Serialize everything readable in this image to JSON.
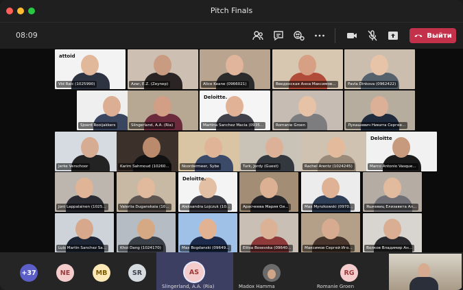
{
  "window": {
    "title": "Pitch Finals"
  },
  "toolbar": {
    "time": "08:09",
    "leave_label": "Выйти"
  },
  "participants": [
    {
      "name": "Vid Raic (1025990)",
      "bg": "#f3f3f3",
      "skin": "#e2b89a",
      "shirt": "#2d3340",
      "logo": "attoid"
    },
    {
      "name": "Azar, E.Z. (Zeynep)",
      "bg": "#cdbfb2",
      "skin": "#c99c82",
      "shirt": "#2a2424",
      "logo": ""
    },
    {
      "name": "Alice Keane (0966021)",
      "bg": "#b8a48f",
      "skin": "#e0b59b",
      "shirt": "#2b2b2b",
      "logo": ""
    },
    {
      "name": "Введенская Анна Максимов...",
      "bg": "#d7c6b0",
      "skin": "#d7a084",
      "shirt": "#b24c3a",
      "logo": ""
    },
    {
      "name": "Pavla Dinkova (0962422)",
      "bg": "#cbbeaf",
      "skin": "#e7c3a7",
      "shirt": "#56616e",
      "logo": ""
    },
    {
      "name": "Sjoerd Rooijakkers",
      "bg": "#efefef",
      "skin": "#dcae93",
      "shirt": "#3a4660",
      "logo": ""
    },
    {
      "name": "Slingerland, A.A. (Ria)",
      "bg": "#b6a892",
      "skin": "#d29e86",
      "shirt": "#6b2b3d",
      "logo": ""
    },
    {
      "name": "Martina Sanchez Macia (0935...",
      "bg": "#f5f5f5",
      "skin": "#e1b296",
      "shirt": "#40414a",
      "logo": "Deloitte."
    },
    {
      "name": "Romanie Groen",
      "bg": "#c6bcb3",
      "skin": "#e6c2a6",
      "shirt": "#7d7d80",
      "logo": ""
    },
    {
      "name": "Лукашевич Никита Сергее...",
      "bg": "#b6ad9f",
      "skin": "#dbb096",
      "shirt": "#1f2a3d",
      "logo": ""
    },
    {
      "name": "Jerke Verschoor",
      "bg": "#d6dbe1",
      "skin": "#d6ad93",
      "shirt": "#232323",
      "logo": ""
    },
    {
      "name": "Karim Sahmoud (10260...",
      "bg": "#3b302a",
      "skin": "#b98a6c",
      "shirt": "#121212",
      "logo": ""
    },
    {
      "name": "Noordermeer, Sybe",
      "bg": "#d9c4a3",
      "skin": "#e0b597",
      "shirt": "#3c4a6a",
      "logo": ""
    },
    {
      "name": "Turk, Jordy (Guest)",
      "bg": "#c9c2b6",
      "skin": "#ddb197",
      "shirt": "#33383f",
      "logo": ""
    },
    {
      "name": "Rachel Arentz (1024245)",
      "bg": "#cfc2b1",
      "skin": "#e3bb9c",
      "shirt": "#9a8a7a",
      "logo": ""
    },
    {
      "name": "Marco Antonio Vasque...",
      "bg": "#f1f1f1",
      "skin": "#c79a7d",
      "shirt": "#1b1b1b",
      "logo": "Deloitte"
    },
    {
      "name": "Joni Lappalainen (1025...",
      "bg": "#bcb6ae",
      "skin": "#dfb497",
      "shirt": "#2b2b33",
      "logo": ""
    },
    {
      "name": "Valeriia Duganskaia (10...",
      "bg": "#c7b9a4",
      "skin": "#e1b99c",
      "shirt": "#5e5550",
      "logo": ""
    },
    {
      "name": "Aleksandra Lojczuk (10...",
      "bg": "#f4f4f4",
      "skin": "#e3bfa3",
      "shirt": "#3e3e48",
      "logo": "Deloitte."
    },
    {
      "name": "Арасчеева Мария Ои...",
      "bg": "#a38d75",
      "skin": "#dcb092",
      "shirt": "#26262b",
      "logo": ""
    },
    {
      "name": "Max Mynzkowski (0970...",
      "bg": "#ececec",
      "skin": "#dfb295",
      "shirt": "#2f3e57",
      "logo": ""
    },
    {
      "name": "Яшкевиц Елизавета Ал...",
      "bg": "#b5aca4",
      "skin": "#e2bb9f",
      "shirt": "#6f6f75",
      "logo": ""
    },
    {
      "name": "Luis Martin Sanchez Sa...",
      "bg": "#cdd3d8",
      "skin": "#d7a88b",
      "shirt": "#1e2636",
      "logo": ""
    },
    {
      "name": "Khoi Dang (1024170)",
      "bg": "#b6bcc4",
      "skin": "#d6a985",
      "shirt": "#3b3f47",
      "logo": ""
    },
    {
      "name": "Max Bogdanski (09649...",
      "bg": "#9fc1e8",
      "skin": "#e1b393",
      "shirt": "#1c2b4b",
      "logo": ""
    },
    {
      "name": "Elitsa Bosevska (09640...",
      "bg": "#c9bfb5",
      "skin": "#dcb296",
      "shirt": "#8e3a3a",
      "logo": ""
    },
    {
      "name": "Максимов Сергей Иго...",
      "bg": "#b49f88",
      "skin": "#d7ab8f",
      "shirt": "#47352c",
      "logo": ""
    },
    {
      "name": "Волков Владимир Ан...",
      "bg": "#d8d4cf",
      "skin": "#d9ae92",
      "shirt": "#2a2a2e",
      "logo": ""
    }
  ],
  "bottom": {
    "more_count": "+37",
    "avatars": [
      {
        "initials": "NE",
        "color": "#f4cccc",
        "text": "#9b3a3a"
      },
      {
        "initials": "MB",
        "color": "#fde9b8",
        "text": "#7a5a00"
      },
      {
        "initials": "SR",
        "color": "#d6dbe0",
        "text": "#39424d"
      },
      {
        "initials": "AS",
        "color": "#f4cccc",
        "text": "#9b3a3a"
      },
      {
        "initials": "RG",
        "color": "#f4cccc",
        "text": "#9b3a3a"
      }
    ],
    "names": [
      "Slingerland, A.A. (Ria)",
      "Madox Hamma",
      "Romanie Groen"
    ]
  },
  "colors": {
    "accent": "#c4314b",
    "selected": "#3d3f62"
  }
}
